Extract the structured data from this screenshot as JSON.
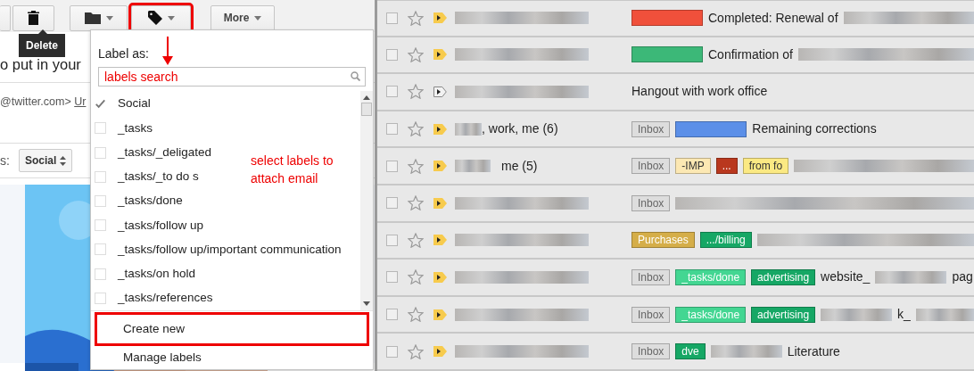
{
  "toolbar": {
    "buttons": [
      {
        "kind": "partial",
        "highlighted": false
      },
      {
        "kind": "delete",
        "highlighted": false
      },
      {
        "kind": "folder",
        "highlighted": false
      },
      {
        "kind": "label",
        "highlighted": true
      },
      {
        "kind": "more",
        "label": "More",
        "highlighted": false
      }
    ]
  },
  "tooltip": "Delete",
  "message": {
    "heading": "o put in your",
    "sender": "@twitter.com>",
    "sender_link": "Ur",
    "category_label": "s:",
    "category_value": "Social"
  },
  "label_menu": {
    "title": "Label as:",
    "search": {
      "value": "labels search"
    },
    "items": [
      {
        "label": "Social",
        "checked": true
      },
      {
        "label": "_tasks",
        "checked": false
      },
      {
        "label": "_tasks/_deligated",
        "checked": false
      },
      {
        "label": "_tasks/_to do s",
        "checked": false
      },
      {
        "label": "_tasks/done",
        "checked": false
      },
      {
        "label": "_tasks/follow up",
        "checked": false
      },
      {
        "label": "_tasks/follow up/important communication",
        "checked": false
      },
      {
        "label": "_tasks/on hold",
        "checked": false
      },
      {
        "label": "_tasks/references",
        "checked": false
      }
    ],
    "actions": [
      {
        "label": "Create new",
        "highlighted": true
      },
      {
        "label": "Manage labels",
        "highlighted": false
      }
    ]
  },
  "annotation": {
    "note": "select labels to attach email"
  },
  "inbox": {
    "rows": [
      {
        "checked": false,
        "important": true,
        "parts": [
          {
            "kind": "chip",
            "color": "#f0503b"
          },
          {
            "kind": "text",
            "text": "Completed: Renewal of"
          },
          {
            "kind": "redacted"
          }
        ]
      },
      {
        "checked": false,
        "important": true,
        "parts": [
          {
            "kind": "chip",
            "color": "#3cb878"
          },
          {
            "kind": "text",
            "text": "Confirmation of"
          },
          {
            "kind": "redacted"
          }
        ]
      },
      {
        "checked": false,
        "important": false,
        "parts": [
          {
            "kind": "text",
            "text": "Hangout with work office"
          }
        ]
      },
      {
        "checked": false,
        "important": true,
        "sender": ", work, me (6)",
        "parts": [
          {
            "kind": "chip",
            "color": "#dddddd",
            "text": "Inbox"
          },
          {
            "kind": "chip",
            "color": "#5b8fe8"
          },
          {
            "kind": "text",
            "text": "Remaining corrections"
          }
        ]
      },
      {
        "checked": false,
        "important": true,
        "sender": "me (5)",
        "parts": [
          {
            "kind": "chip",
            "color": "#dddddd",
            "text": "Inbox"
          },
          {
            "kind": "chip",
            "color": "#fce8b3",
            "text": "-IMP"
          },
          {
            "kind": "chip",
            "color": "#b9381e",
            "text": "..."
          },
          {
            "kind": "chip",
            "color": "#fbe983",
            "text": "from fo"
          },
          {
            "kind": "redacted"
          }
        ]
      },
      {
        "checked": false,
        "important": true,
        "parts": [
          {
            "kind": "chip",
            "color": "#dddddd",
            "text": "Inbox"
          },
          {
            "kind": "redacted"
          }
        ]
      },
      {
        "checked": false,
        "important": true,
        "parts": [
          {
            "kind": "chip",
            "color": "#d5ae49",
            "text": "Purchases"
          },
          {
            "kind": "chip",
            "color": "#16a765",
            "text": ".../billing"
          },
          {
            "kind": "redacted"
          }
        ]
      },
      {
        "checked": false,
        "important": true,
        "parts": [
          {
            "kind": "chip",
            "color": "#dddddd",
            "text": "Inbox"
          },
          {
            "kind": "chip",
            "color": "#43d692",
            "text": "_tasks/done"
          },
          {
            "kind": "chip",
            "color": "#16a765",
            "text": "advertising"
          },
          {
            "kind": "text",
            "text": "website_"
          },
          {
            "kind": "redacted"
          },
          {
            "kind": "text",
            "text": "pag"
          }
        ]
      },
      {
        "checked": false,
        "important": true,
        "parts": [
          {
            "kind": "chip",
            "color": "#dddddd",
            "text": "Inbox"
          },
          {
            "kind": "chip",
            "color": "#43d692",
            "text": "_tasks/done"
          },
          {
            "kind": "chip",
            "color": "#16a765",
            "text": "advertising"
          },
          {
            "kind": "redacted"
          },
          {
            "kind": "text",
            "text": "k_"
          },
          {
            "kind": "redacted"
          }
        ]
      },
      {
        "checked": false,
        "important": true,
        "parts": [
          {
            "kind": "chip",
            "color": "#dddddd",
            "text": "Inbox"
          },
          {
            "kind": "chip",
            "color": "#16a765",
            "text": "dve"
          },
          {
            "kind": "redacted"
          },
          {
            "kind": "text",
            "text": "Literature"
          }
        ]
      }
    ]
  }
}
